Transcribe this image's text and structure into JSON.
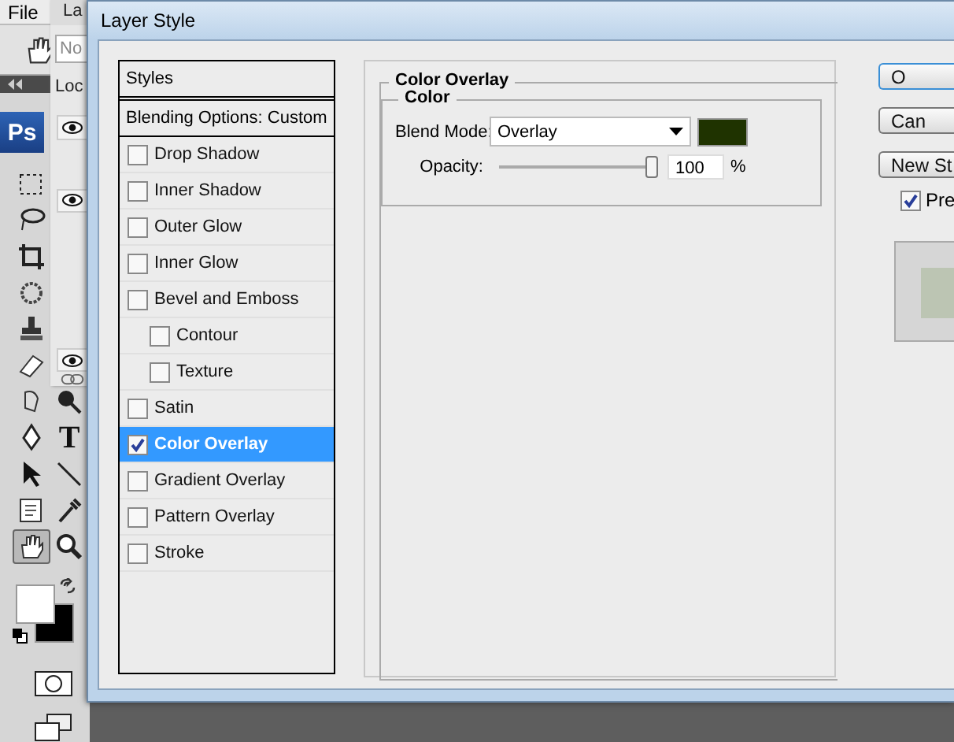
{
  "app": {
    "menu": [
      {
        "label": "File"
      }
    ],
    "logo": "Ps",
    "text_tool": "T"
  },
  "layers_panel": {
    "tab": "La",
    "blend_field": "No",
    "lock_label": "Loc"
  },
  "dialog": {
    "title": "Layer Style",
    "styles_header": "Styles",
    "blending_options": "Blending Options: Custom",
    "styles": [
      {
        "label": "Drop Shadow",
        "checked": false,
        "selected": false
      },
      {
        "label": "Inner Shadow",
        "checked": false,
        "selected": false
      },
      {
        "label": "Outer Glow",
        "checked": false,
        "selected": false
      },
      {
        "label": "Inner Glow",
        "checked": false,
        "selected": false
      },
      {
        "label": "Bevel and Emboss",
        "checked": false,
        "selected": false,
        "children": [
          {
            "label": "Contour",
            "checked": false,
            "selected": false
          },
          {
            "label": "Texture",
            "checked": false,
            "selected": false
          }
        ]
      },
      {
        "label": "Satin",
        "checked": false,
        "selected": false
      },
      {
        "label": "Color Overlay",
        "checked": true,
        "selected": true
      },
      {
        "label": "Gradient Overlay",
        "checked": false,
        "selected": false
      },
      {
        "label": "Pattern Overlay",
        "checked": false,
        "selected": false
      },
      {
        "label": "Stroke",
        "checked": false,
        "selected": false
      }
    ],
    "panel": {
      "title": "Color Overlay",
      "group": "Color",
      "blend_mode_label": "Blend Mode:",
      "blend_mode": "Overlay",
      "color": "#1f3300",
      "opacity_label": "Opacity:",
      "opacity": {
        "level": 1.0
      },
      "opacity_value": "100",
      "opacity_unit": "%"
    },
    "buttons": [
      {
        "label": "O"
      },
      {
        "label": "Can"
      },
      {
        "label": "New St"
      }
    ],
    "preview": {
      "label": "Pre",
      "checked": true
    }
  }
}
